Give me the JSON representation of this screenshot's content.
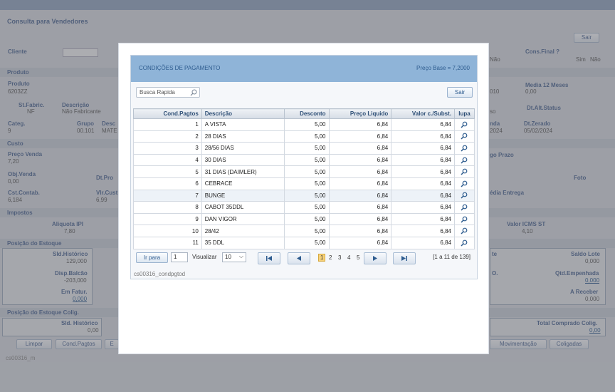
{
  "background": {
    "page_title": "Consulta para Vendedores",
    "sair_label": "Sair",
    "cliente_label": "Cliente",
    "cons_final_label": "Cons.Final ?",
    "sim_label": "Sim",
    "nao_label": "Não",
    "sim_label_2": "Sim",
    "nao_label_2": "Não",
    "produto_section": "Produto",
    "produto_label": "Produto",
    "produto_value": "6203ZZ",
    "stfabric_label": "St.Fabric.",
    "stfabric_value": "NF",
    "descricao_label": "Descrição",
    "descricao_value": "Não Fabricante",
    "media_label": "Media 12 Meses",
    "media_value": "0,00",
    "val_010": "010",
    "dtalt_label": "Dt.Alt.Status",
    "iso_text": "so",
    "categ_label": "Categ.",
    "categ_value": "9",
    "grupo_label": "Grupo",
    "grupo_value": "00.101",
    "desc_short": "Desc",
    "mate_text": "MATE",
    "nda_text": "nda",
    "nda_date": "2024",
    "dtzerado_label": "Dt.Zerado",
    "dtzerado_value": "05/02/2024",
    "custo_section": "Custo",
    "precovenda_label": "Preço Venda",
    "precovenda_value": "7,20",
    "prazo_label": "go Prazo",
    "objvenda_label": "Obj.Venda",
    "objvenda_value": "0,00",
    "dtpro_label": "Dt.Pro",
    "foto_label": "Foto",
    "cstcontab_label": "Cst.Contab.",
    "cstcontab_value": "6,184",
    "vlrcust_label": "Vlr.Cust",
    "vlrcust_value": "6,99",
    "mediaentrega_label": "édia Entrega",
    "impostos_section": "Impostos",
    "aliqipi_label": "Aliquota IPI",
    "aliqipi_value": "7,80",
    "valoricms_label": "Valor ICMS ST",
    "valoricms_value": "4,10",
    "posicao_section": "Posição do Estoque",
    "sldhist_label": "Sld.Histórico",
    "sldhist_value": "129,000",
    "saldolote_label": "Saldo Lote",
    "saldolote_value": "0,000",
    "dispbalcao_label": "Disp.Balcão",
    "dispbalcao_value": "-203,000",
    "qtdemp_label": "Qtd.Empenhada",
    "qtdemp_value": "0,000",
    "emfatur_label": "Em Fatur.",
    "emfatur_value": "0,000",
    "areceber_label": "A Receber",
    "areceber_value": "0,000",
    "te_text": "te",
    "o_text": "O.",
    "posicaocolig_section": "Posição do Estoque Colig.",
    "sldhist2_label": "Sld. Histórico",
    "sldhist2_value": "0,00",
    "totalcomprado_label": "Total Comprado Colig.",
    "totalcomprado_value": "0,00",
    "limpar_label": "Limpar",
    "condpagtos_label": "Cond.Pagtos",
    "e_label": "E",
    "movimentacao_label": "Movimentação",
    "coligadas_label": "Coligadas",
    "footer_code": "cs00316_m"
  },
  "modal": {
    "title": "CONDIÇÕES DE PAGAMENTO",
    "preco_base": "Preço Base = 7,2000",
    "search_placeholder": "Busca Rapida",
    "sair_label": "Sair",
    "columns": [
      "Cond.Pagtos",
      "Descrição",
      "Desconto",
      "Preço Liquido",
      "Valor c./Subst.",
      "lupa"
    ],
    "rows": [
      {
        "cod": "1",
        "desc": "A VISTA",
        "desconto": "5,00",
        "liquido": "6,84",
        "subst": "6,84"
      },
      {
        "cod": "2",
        "desc": "28 DIAS",
        "desconto": "5,00",
        "liquido": "6,84",
        "subst": "6,84"
      },
      {
        "cod": "3",
        "desc": "28/56 DIAS",
        "desconto": "5,00",
        "liquido": "6,84",
        "subst": "6,84"
      },
      {
        "cod": "4",
        "desc": "30 DIAS",
        "desconto": "5,00",
        "liquido": "6,84",
        "subst": "6,84"
      },
      {
        "cod": "5",
        "desc": "31 DIAS (DAIMLER)",
        "desconto": "5,00",
        "liquido": "6,84",
        "subst": "6,84"
      },
      {
        "cod": "6",
        "desc": "CEBRACE",
        "desconto": "5,00",
        "liquido": "6,84",
        "subst": "6,84"
      },
      {
        "cod": "7",
        "desc": "BUNGE",
        "desconto": "5,00",
        "liquido": "6,84",
        "subst": "6,84"
      },
      {
        "cod": "8",
        "desc": "CABOT 35DDL",
        "desconto": "5,00",
        "liquido": "6,84",
        "subst": "6,84"
      },
      {
        "cod": "9",
        "desc": "DAN VIGOR",
        "desconto": "5,00",
        "liquido": "6,84",
        "subst": "6,84"
      },
      {
        "cod": "10",
        "desc": "28/42",
        "desconto": "5,00",
        "liquido": "6,84",
        "subst": "6,84"
      },
      {
        "cod": "11",
        "desc": "35 DDL",
        "desconto": "5,00",
        "liquido": "6,84",
        "subst": "6,84"
      }
    ],
    "pager": {
      "ir_para": "Ir para",
      "page_value": "1",
      "visualizar": "Visualizar",
      "per_page": "10",
      "pages": [
        "1",
        "2",
        "3",
        "4",
        "5"
      ],
      "summary": "[1 a 11 de 139]"
    },
    "footer_code": "cs00316_condpgtod"
  },
  "colors": {
    "modal_header": "#8fb4d8",
    "active_page": "#f7d27a",
    "accent_text": "#2e5c8f"
  }
}
